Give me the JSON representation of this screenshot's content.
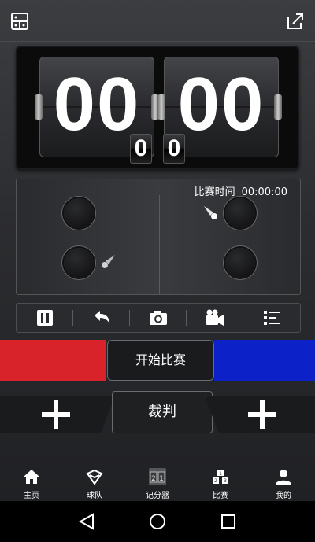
{
  "scoreboard": {
    "left_score": "00",
    "right_score": "00",
    "left_games": "0",
    "right_games": "0"
  },
  "court": {
    "match_time_label": "比赛时间",
    "match_time_value": "00:00:00"
  },
  "toolbar": {
    "items": [
      "pause-icon",
      "undo-icon",
      "camera-icon",
      "video-icon",
      "list-icon"
    ]
  },
  "controls": {
    "start_label": "开始比赛",
    "referee_label": "裁判",
    "left_team_color": "#d8232a",
    "right_team_color": "#0c22c8"
  },
  "nav": {
    "items": [
      {
        "label": "主页",
        "icon": "home-icon"
      },
      {
        "label": "球队",
        "icon": "team-icon"
      },
      {
        "label": "记分器",
        "icon": "scorer-icon"
      },
      {
        "label": "比赛",
        "icon": "match-icon"
      },
      {
        "label": "我的",
        "icon": "profile-icon"
      }
    ]
  }
}
